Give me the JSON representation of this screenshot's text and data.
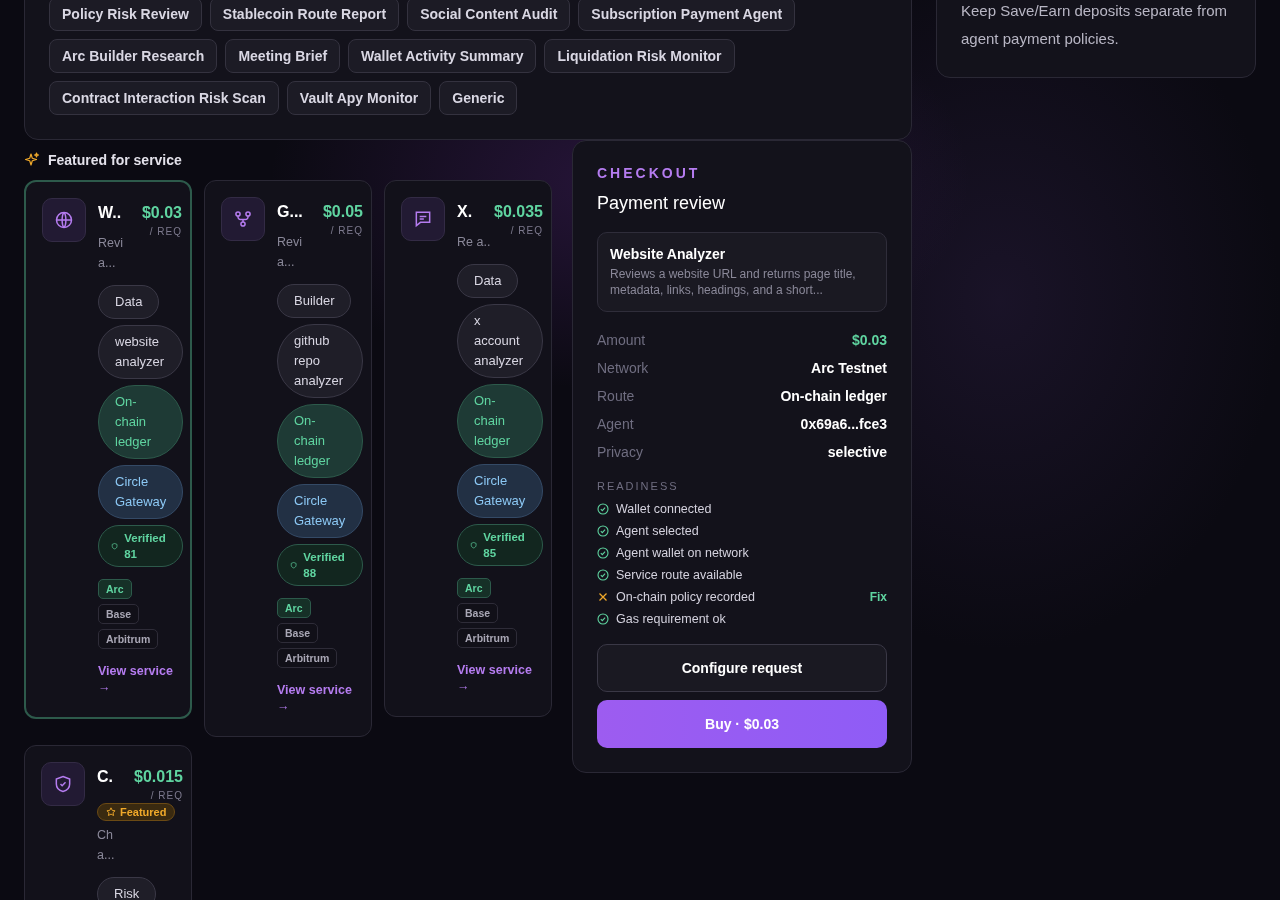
{
  "template_chips": [
    {
      "label": "Policy Risk Review"
    },
    {
      "label": "Stablecoin Route Report"
    },
    {
      "label": "Social Content Audit"
    },
    {
      "label": "Subscription Payment Agent"
    },
    {
      "label": "Arc Builder Research"
    },
    {
      "label": "Meeting Brief"
    },
    {
      "label": "Wallet Activity Summary"
    },
    {
      "label": "Liquidation Risk Monitor"
    },
    {
      "label": "Contract Interaction Risk Scan"
    },
    {
      "label": "Vault Apy Monitor"
    },
    {
      "label": "Generic"
    }
  ],
  "policy_note": "Keep Save/Earn deposits separate from agent payment policies.",
  "featured": {
    "title": "Featured for service",
    "cards": [
      {
        "selected": true,
        "title": "W..",
        "price": "$0.03",
        "unit": "/ REQ",
        "description": "Revi a...",
        "category": "Data",
        "tag": "website analyzer",
        "route": "On-chain ledger",
        "gateway": "Circle Gateway",
        "verified": "Verified 81",
        "networks": [
          {
            "label": "Arc",
            "selected": true
          },
          {
            "label": "Base",
            "selected": false
          },
          {
            "label": "Arbitrum",
            "selected": false
          }
        ],
        "link": "View service →"
      },
      {
        "selected": false,
        "title": "G...",
        "price": "$0.05",
        "unit": "/ REQ",
        "description": "Revi a...",
        "category": "Builder",
        "tag": "github repo analyzer",
        "route": "On-chain ledger",
        "gateway": "Circle Gateway",
        "verified": "Verified 88",
        "networks": [
          {
            "label": "Arc",
            "selected": true
          },
          {
            "label": "Base",
            "selected": false
          },
          {
            "label": "Arbitrum",
            "selected": false
          }
        ],
        "link": "View service →"
      },
      {
        "selected": false,
        "title": "X.",
        "price": "$0.035",
        "unit": "/ REQ",
        "description": "Re a..",
        "category": "Data",
        "tag": "x account analyzer",
        "route": "On-chain ledger",
        "gateway": "Circle Gateway",
        "verified": "Verified 85",
        "networks": [
          {
            "label": "Arc",
            "selected": true
          },
          {
            "label": "Base",
            "selected": false
          },
          {
            "label": "Arbitrum",
            "selected": false
          }
        ],
        "link": "View service →"
      },
      {
        "selected": false,
        "title": "C.",
        "price": "$0.015",
        "unit": "/ REQ",
        "badge": "Featured",
        "description": "Ch a...",
        "category": "Risk"
      }
    ]
  },
  "checkout": {
    "eyebrow": "CHECKOUT",
    "title": "Payment review",
    "service": {
      "name": "Website Analyzer",
      "description": "Reviews a website URL and returns page title, metadata, links, headings, and a short..."
    },
    "rows": [
      {
        "label": "Amount",
        "value": "$0.03",
        "kind": "amount"
      },
      {
        "label": "Network",
        "value": "Arc Testnet",
        "kind": "plain"
      },
      {
        "label": "Route",
        "value": "On-chain ledger",
        "kind": "plain"
      },
      {
        "label": "Agent",
        "value": "0x69a6...fce3",
        "kind": "plain"
      },
      {
        "label": "Privacy",
        "value": "selective",
        "kind": "plain"
      }
    ],
    "readiness_title": "READINESS",
    "readiness": [
      {
        "label": "Wallet connected",
        "ok": true
      },
      {
        "label": "Agent selected",
        "ok": true
      },
      {
        "label": "Agent wallet on network",
        "ok": true
      },
      {
        "label": "Service route available",
        "ok": true
      },
      {
        "label": "On-chain policy recorded",
        "ok": false,
        "action": "Fix"
      },
      {
        "label": "Gas requirement ok",
        "ok": true
      }
    ],
    "configure_button": "Configure request",
    "buy_button": "Buy · $0.03"
  }
}
